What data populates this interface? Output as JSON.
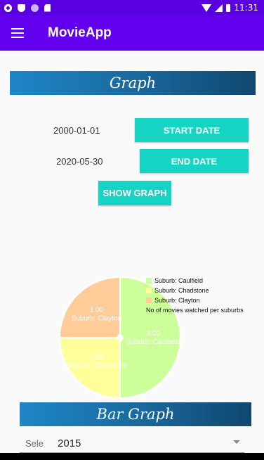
{
  "status_bar": {
    "time": "11:31",
    "left_icons": [
      "settings-icon",
      "shield-icon",
      "circle-icon",
      "sd-card-icon"
    ],
    "right_icons": [
      "wifi-icon",
      "signal-icon",
      "battery-icon"
    ]
  },
  "app_bar": {
    "title": "MovieApp",
    "menu_icon": "hamburger-menu-icon"
  },
  "graph_section": {
    "title": "Graph",
    "start_date_value": "2000-01-01",
    "start_date_button": "START DATE",
    "end_date_value": "2020-05-30",
    "end_date_button": "END DATE",
    "show_graph_button": "SHOW GRAPH",
    "button_color": "#15d4c3"
  },
  "chart_data": {
    "type": "pie",
    "description": "No of movies watched per suburbs",
    "legend_position": "top-right",
    "slices": [
      {
        "label": "Suburb: Caulfield",
        "value": 2.0,
        "value_text": "2.00",
        "color": "#ccff99"
      },
      {
        "label": "Suburb: Chadstone",
        "value": 1.0,
        "value_text": "1.00",
        "color": "#ffff99"
      },
      {
        "label": "Suburb: Clayton",
        "value": 1.0,
        "value_text": "1.00",
        "color": "#ffcc99"
      }
    ]
  },
  "bar_section": {
    "title": "Bar Graph",
    "select_label": "Sele",
    "select_value": "2015"
  }
}
